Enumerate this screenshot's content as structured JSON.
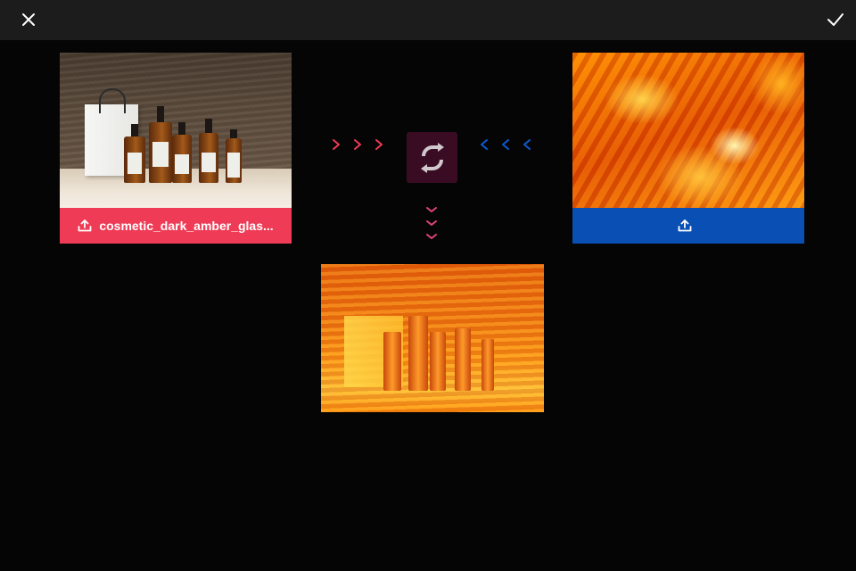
{
  "toolbar": {
    "close_icon": "close-icon",
    "confirm_icon": "check-icon"
  },
  "source_left": {
    "filename": "cosmetic_dark_amber_glas...",
    "upload_icon": "upload-icon",
    "accent": "#ef3b55"
  },
  "source_right": {
    "filename": "",
    "upload_icon": "upload-icon",
    "accent": "#0a4fb3"
  },
  "swap": {
    "icon": "swap-icon",
    "background": "#3a0c24"
  }
}
